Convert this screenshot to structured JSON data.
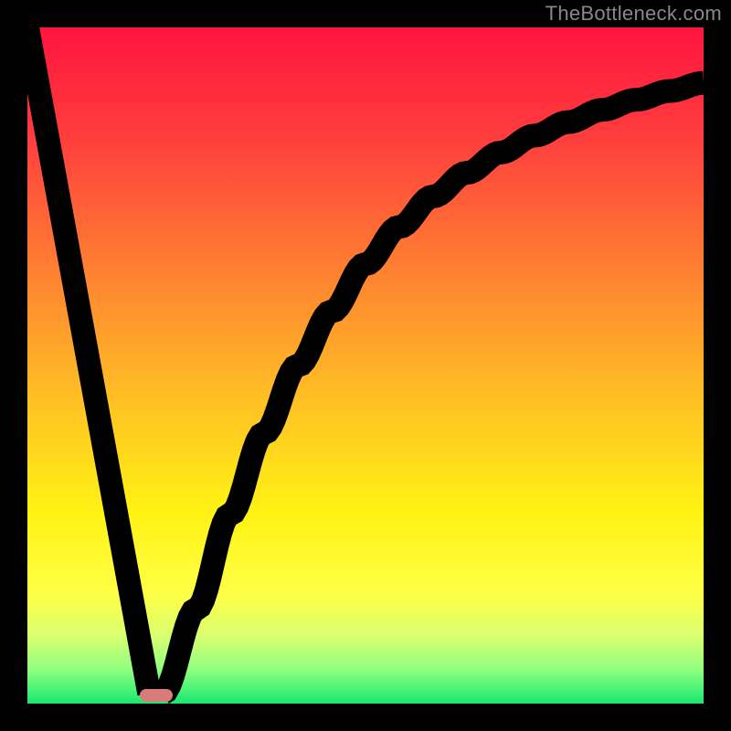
{
  "watermark": "TheBottleneck.com",
  "chart_data": {
    "type": "line",
    "title": "",
    "xlabel": "",
    "ylabel": "",
    "xlim": [
      0,
      100
    ],
    "ylim": [
      0,
      100
    ],
    "grid": false,
    "legend": false,
    "annotations": [],
    "series": [
      {
        "name": "left-branch",
        "x": [
          0,
          18
        ],
        "y": [
          100,
          1.5
        ]
      },
      {
        "name": "right-branch",
        "x": [
          20,
          25,
          30,
          35,
          40,
          45,
          50,
          55,
          60,
          65,
          70,
          75,
          80,
          85,
          90,
          95,
          100
        ],
        "y": [
          1.5,
          14,
          28,
          40,
          50,
          58,
          65,
          70.5,
          75,
          78.5,
          81.5,
          84,
          86,
          87.8,
          89.3,
          90.6,
          91.8
        ]
      }
    ],
    "marker": {
      "x": 19,
      "y": 1.2,
      "shape": "pill",
      "color": "#d97b7a"
    },
    "background_gradient": {
      "type": "linear-vertical",
      "stops": [
        {
          "pos": 0.0,
          "color": "#ff153f"
        },
        {
          "pos": 0.15,
          "color": "#ff3a3e"
        },
        {
          "pos": 0.35,
          "color": "#ff7d32"
        },
        {
          "pos": 0.55,
          "color": "#ffc024"
        },
        {
          "pos": 0.72,
          "color": "#fff314"
        },
        {
          "pos": 0.84,
          "color": "#ffff47"
        },
        {
          "pos": 0.9,
          "color": "#d9ff70"
        },
        {
          "pos": 0.95,
          "color": "#8fff80"
        },
        {
          "pos": 1.0,
          "color": "#18e86f"
        }
      ]
    }
  }
}
